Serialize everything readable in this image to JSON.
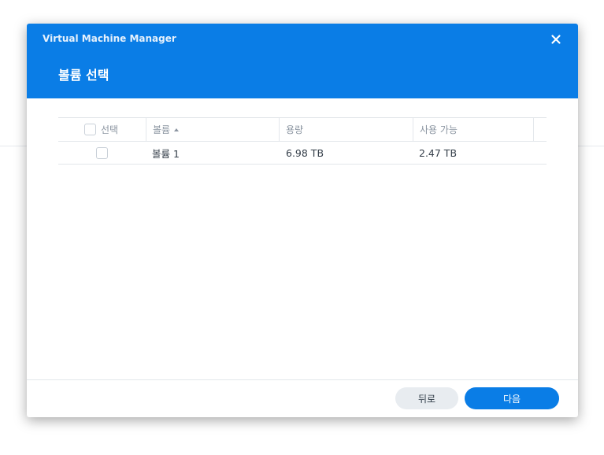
{
  "dialog": {
    "app_title": "Virtual Machine Manager",
    "step_title": "볼륨 선택",
    "close_icon": "close-icon"
  },
  "table": {
    "columns": [
      {
        "label": "선택"
      },
      {
        "label": "볼륨",
        "sort": "ascending"
      },
      {
        "label": "용량"
      },
      {
        "label": "사용 가능"
      }
    ],
    "rows": [
      {
        "selected": false,
        "volume": "볼륨 1",
        "capacity": "6.98 TB",
        "available": "2.47 TB"
      }
    ]
  },
  "footer": {
    "back_label": "뒤로",
    "next_label": "다음"
  },
  "colors": {
    "accent": "#0a7de6",
    "back_button_bg": "#e8ecf0"
  }
}
